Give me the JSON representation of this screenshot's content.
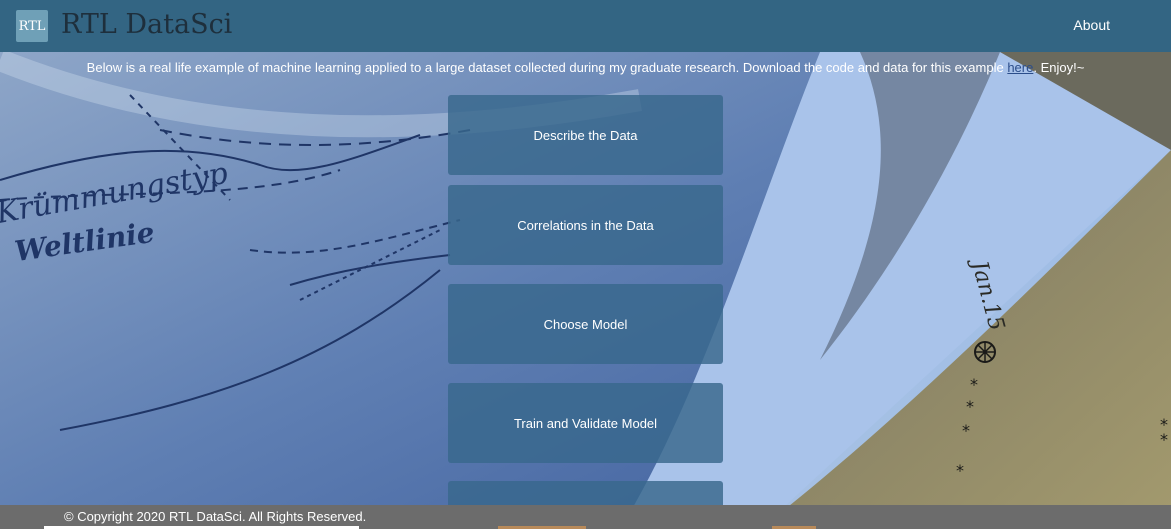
{
  "navbar": {
    "logo_text": "RTL",
    "brand": "RTL DataSci",
    "about_label": "About"
  },
  "intro": {
    "text_before": "Below is a real life example of machine learning applied to a large dataset collected during my graduate research. Download the code and data for this example ",
    "link_text": "here",
    "text_after": ". Enjoy!~"
  },
  "cards": [
    {
      "label": "Describe the Data"
    },
    {
      "label": "Correlations in the Data"
    },
    {
      "label": "Choose Model"
    },
    {
      "label": "Train and Validate Model"
    },
    {
      "label": ""
    }
  ],
  "background": {
    "text_1": "Krümmungstyp",
    "text_2": "Weltlinie",
    "text_3": "Jan.15"
  },
  "footer": {
    "copyright": "© Copyright 2020 RTL DataSci. All Rights Reserved."
  },
  "colors": {
    "navbar": "#336583",
    "card": "#38688c",
    "footer": "#6c6c6c"
  }
}
